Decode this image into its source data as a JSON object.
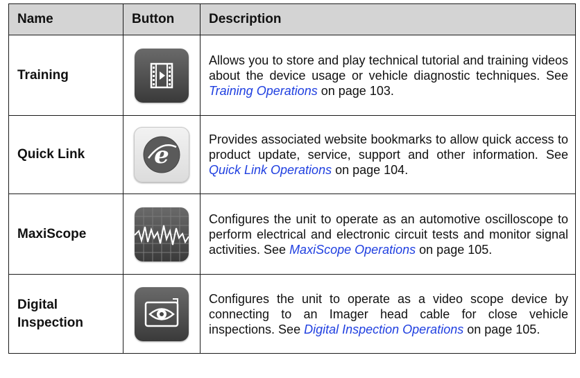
{
  "table": {
    "headers": [
      "Name",
      "Button",
      "Description"
    ],
    "rows": [
      {
        "name": "Training",
        "icon": "training-film-icon",
        "desc_before": "Allows you to store and play technical tutorial and training videos about the device usage or vehicle diagnostic techniques. See ",
        "link": "Training Operations",
        "desc_after": " on page 103."
      },
      {
        "name": "Quick Link",
        "icon": "quick-link-browser-icon",
        "desc_before": "Provides associated website bookmarks to allow quick access to product update, service, support and other information. See ",
        "link": "Quick Link Operations",
        "desc_after": " on page 104."
      },
      {
        "name": "MaxiScope",
        "icon": "maxiscope-waveform-icon",
        "desc_before": "Configures the unit to operate as an automotive oscilloscope to perform electrical and electronic circuit tests and monitor signal activities. See ",
        "link": "MaxiScope Operations",
        "desc_after": " on page 105."
      },
      {
        "name_line1": "Digital",
        "name_line2": "Inspection",
        "icon": "digital-inspection-eye-icon",
        "desc_before": "Configures the unit to operate as a video scope device by connecting to an Imager head cable for close vehicle inspections. See ",
        "link": "Digital Inspection Operations",
        "desc_after": " on page 105."
      }
    ]
  },
  "colors": {
    "header_bg": "#d4d4d4",
    "link": "#1f3fe0",
    "border": "#1a1a1a"
  }
}
